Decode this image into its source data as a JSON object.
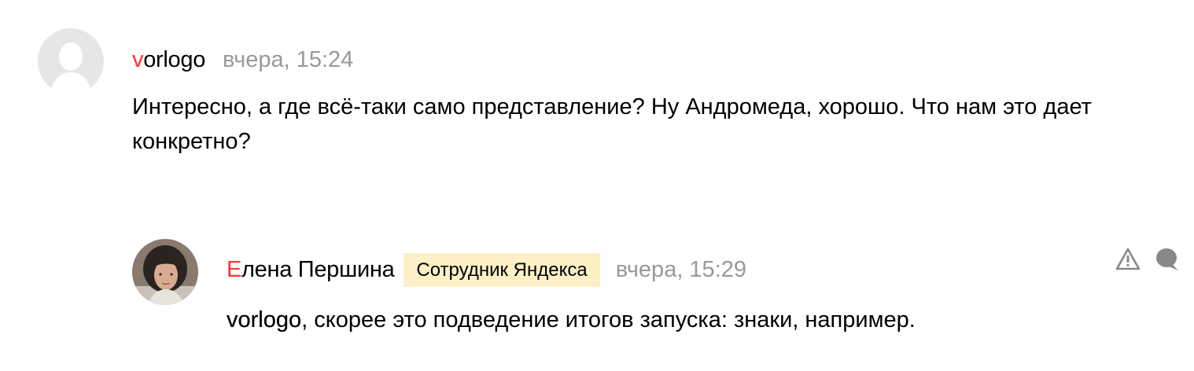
{
  "comments": [
    {
      "author_first": "v",
      "author_rest": "orlogo",
      "time": "вчера, 15:24",
      "text": "Интересно, а где всё-таки само представление? Ну Андромеда, хорошо. Что нам это дает конкретно?"
    },
    {
      "author_first": "Е",
      "author_rest": "лена Першина",
      "badge": "Сотрудник Яндекса",
      "time": "вчера, 15:29",
      "mention": "vorlogo",
      "text": ", скорее это подведение итогов запуска: знаки, например."
    }
  ],
  "icons": {
    "report": "warning-triangle-icon",
    "reply": "speech-bubble-icon"
  },
  "colors": {
    "author_accent": "#ff3333",
    "timestamp": "#999999",
    "badge_bg": "#fdefc6"
  }
}
